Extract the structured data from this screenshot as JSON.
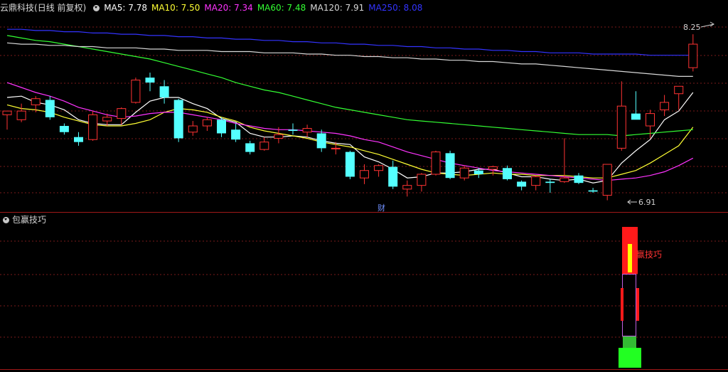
{
  "header": {
    "stock_name": "云鼎科技",
    "period": "(日线 前复权)",
    "ma": [
      {
        "label": "MA5: 7.78",
        "color": "#ffffff"
      },
      {
        "label": "MA10: 7.50",
        "color": "#ffff33"
      },
      {
        "label": "MA20: 7.34",
        "color": "#ff33ff"
      },
      {
        "label": "MA60: 7.48",
        "color": "#33ff33"
      },
      {
        "label": "MA120: 7.91",
        "color": "#d8d8d8"
      },
      {
        "label": "MA250: 8.08",
        "color": "#3333ff"
      }
    ]
  },
  "indicator": {
    "name": "包赢技巧",
    "signal_label": "赢技巧"
  },
  "annotations": {
    "high_label": "8.25",
    "low_label": "6.91",
    "event_mark": "财"
  },
  "colors": {
    "up": "#ff3333",
    "down": "#54ffff",
    "grid": "#7a1a1a",
    "divider": "#a01818"
  },
  "chart_data": {
    "type": "candlestick",
    "ylim": [
      6.85,
      8.4
    ],
    "candles": [
      [
        7.6,
        7.63,
        7.48,
        7.63
      ],
      [
        7.56,
        7.69,
        7.54,
        7.63
      ],
      [
        7.68,
        7.75,
        7.62,
        7.73
      ],
      [
        7.72,
        7.75,
        7.56,
        7.58
      ],
      [
        7.51,
        7.53,
        7.44,
        7.46
      ],
      [
        7.42,
        7.46,
        7.35,
        7.38
      ],
      [
        7.4,
        7.63,
        7.39,
        7.6
      ],
      [
        7.55,
        7.61,
        7.51,
        7.58
      ],
      [
        7.57,
        7.66,
        7.52,
        7.65
      ],
      [
        7.7,
        7.9,
        7.69,
        7.88
      ],
      [
        7.9,
        7.94,
        7.79,
        7.86
      ],
      [
        7.83,
        7.88,
        7.69,
        7.74
      ],
      [
        7.72,
        7.73,
        7.38,
        7.41
      ],
      [
        7.46,
        7.55,
        7.43,
        7.51
      ],
      [
        7.51,
        7.58,
        7.47,
        7.56
      ],
      [
        7.56,
        7.58,
        7.42,
        7.45
      ],
      [
        7.48,
        7.53,
        7.38,
        7.4
      ],
      [
        7.37,
        7.39,
        7.28,
        7.3
      ],
      [
        7.32,
        7.42,
        7.31,
        7.38
      ],
      [
        7.41,
        7.5,
        7.37,
        7.44
      ],
      [
        7.48,
        7.53,
        7.44,
        7.47
      ],
      [
        7.46,
        7.52,
        7.42,
        7.49
      ],
      [
        7.45,
        7.48,
        7.3,
        7.33
      ],
      [
        7.33,
        7.38,
        7.28,
        7.33
      ],
      [
        7.3,
        7.31,
        7.08,
        7.1
      ],
      [
        7.09,
        7.2,
        7.04,
        7.15
      ],
      [
        7.15,
        7.2,
        7.1,
        7.19
      ],
      [
        7.18,
        7.23,
        7.0,
        7.02
      ],
      [
        7.0,
        7.07,
        6.94,
        7.03
      ],
      [
        7.03,
        7.13,
        6.98,
        7.12
      ],
      [
        7.12,
        7.31,
        7.11,
        7.3
      ],
      [
        7.29,
        7.31,
        7.08,
        7.09
      ],
      [
        7.09,
        7.19,
        7.07,
        7.17
      ],
      [
        7.15,
        7.17,
        7.09,
        7.12
      ],
      [
        7.16,
        7.19,
        7.11,
        7.18
      ],
      [
        7.17,
        7.19,
        7.07,
        7.08
      ],
      [
        7.06,
        7.07,
        6.99,
        7.02
      ],
      [
        7.03,
        7.11,
        6.99,
        7.1
      ],
      [
        7.06,
        7.08,
        6.97,
        7.05
      ],
      [
        7.06,
        7.41,
        7.05,
        7.09
      ],
      [
        7.11,
        7.13,
        7.04,
        7.05
      ],
      [
        6.99,
        7.01,
        6.97,
        6.98
      ],
      [
        6.95,
        7.2,
        6.91,
        7.2
      ],
      [
        7.33,
        7.87,
        7.31,
        7.67
      ],
      [
        7.61,
        7.79,
        7.57,
        7.56
      ],
      [
        7.51,
        7.64,
        7.41,
        7.61
      ],
      [
        7.64,
        7.76,
        7.59,
        7.7
      ],
      [
        7.77,
        7.83,
        7.64,
        7.83
      ],
      [
        7.98,
        8.25,
        7.95,
        8.17
      ]
    ],
    "ma_lines": [
      {
        "name": "MA5",
        "values": [
          7.74,
          7.75,
          7.7,
          7.68,
          7.64,
          7.56,
          7.53,
          7.52,
          7.52,
          7.62,
          7.71,
          7.74,
          7.74,
          7.69,
          7.65,
          7.57,
          7.54,
          7.45,
          7.42,
          7.42,
          7.43,
          7.42,
          7.39,
          7.37,
          7.36,
          7.26,
          7.22,
          7.16,
          7.09,
          7.1,
          7.13,
          7.13,
          7.14,
          7.16,
          7.16,
          7.13,
          7.1,
          7.1,
          7.08,
          7.07,
          7.08,
          7.05,
          7.07,
          7.21,
          7.31,
          7.4,
          7.56,
          7.63,
          7.78
        ]
      },
      {
        "name": "MA10",
        "values": [
          7.68,
          7.65,
          7.64,
          7.62,
          7.58,
          7.55,
          7.52,
          7.51,
          7.51,
          7.53,
          7.56,
          7.62,
          7.65,
          7.64,
          7.62,
          7.58,
          7.55,
          7.5,
          7.47,
          7.45,
          7.43,
          7.41,
          7.38,
          7.36,
          7.34,
          7.31,
          7.28,
          7.24,
          7.2,
          7.16,
          7.13,
          7.12,
          7.11,
          7.12,
          7.13,
          7.12,
          7.12,
          7.11,
          7.11,
          7.11,
          7.1,
          7.09,
          7.09,
          7.12,
          7.15,
          7.21,
          7.28,
          7.35,
          7.5
        ]
      },
      {
        "name": "MA20",
        "values": [
          7.86,
          7.82,
          7.78,
          7.75,
          7.71,
          7.66,
          7.63,
          7.6,
          7.58,
          7.59,
          7.61,
          7.62,
          7.62,
          7.6,
          7.58,
          7.56,
          7.53,
          7.51,
          7.49,
          7.48,
          7.48,
          7.47,
          7.46,
          7.45,
          7.43,
          7.4,
          7.38,
          7.34,
          7.3,
          7.27,
          7.24,
          7.21,
          7.19,
          7.17,
          7.15,
          7.14,
          7.13,
          7.12,
          7.11,
          7.1,
          7.09,
          7.08,
          7.07,
          7.08,
          7.09,
          7.11,
          7.14,
          7.19,
          7.25
        ]
      },
      {
        "name": "MA60",
        "values": [
          8.24,
          8.22,
          8.2,
          8.19,
          8.17,
          8.15,
          8.13,
          8.11,
          8.09,
          8.07,
          8.05,
          8.02,
          7.99,
          7.96,
          7.93,
          7.9,
          7.86,
          7.83,
          7.8,
          7.78,
          7.75,
          7.72,
          7.69,
          7.66,
          7.64,
          7.62,
          7.6,
          7.58,
          7.56,
          7.55,
          7.54,
          7.53,
          7.52,
          7.51,
          7.5,
          7.49,
          7.48,
          7.47,
          7.46,
          7.45,
          7.44,
          7.44,
          7.44,
          7.43,
          7.44,
          7.45,
          7.46,
          7.47,
          7.48
        ]
      },
      {
        "name": "MA120",
        "values": [
          8.18,
          8.17,
          8.17,
          8.16,
          8.16,
          8.15,
          8.15,
          8.14,
          8.14,
          8.14,
          8.13,
          8.13,
          8.12,
          8.12,
          8.12,
          8.11,
          8.11,
          8.11,
          8.1,
          8.1,
          8.1,
          8.09,
          8.09,
          8.08,
          8.08,
          8.07,
          8.07,
          8.06,
          8.06,
          8.05,
          8.05,
          8.04,
          8.04,
          8.03,
          8.03,
          8.02,
          8.01,
          8.01,
          8.0,
          7.99,
          7.98,
          7.97,
          7.96,
          7.95,
          7.94,
          7.93,
          7.92,
          7.91,
          7.91
        ]
      },
      {
        "name": "MA250",
        "values": [
          8.29,
          8.29,
          8.28,
          8.28,
          8.27,
          8.27,
          8.26,
          8.26,
          8.25,
          8.25,
          8.24,
          8.24,
          8.23,
          8.23,
          8.22,
          8.22,
          8.21,
          8.21,
          8.2,
          8.2,
          8.19,
          8.19,
          8.18,
          8.18,
          8.17,
          8.17,
          8.16,
          8.16,
          8.15,
          8.15,
          8.14,
          8.14,
          8.13,
          8.13,
          8.12,
          8.12,
          8.11,
          8.11,
          8.1,
          8.1,
          8.1,
          8.09,
          8.09,
          8.09,
          8.09,
          8.08,
          8.08,
          8.08,
          8.08
        ]
      }
    ]
  }
}
